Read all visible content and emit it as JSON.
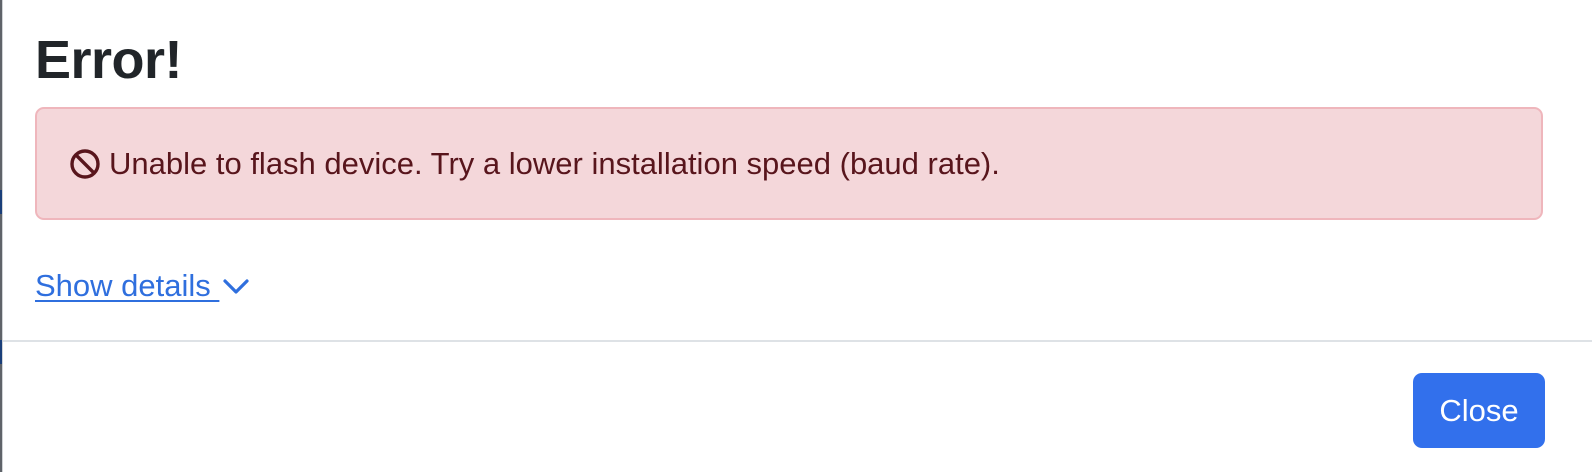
{
  "dialog": {
    "title": "Error!",
    "alert": {
      "icon": "prohibited-icon",
      "message": "Unable to flash device. Try a lower installation speed (baud rate).",
      "background_color": "#f4d7da",
      "border_color": "#efb6bc",
      "text_color": "#58151c"
    },
    "details_toggle": {
      "label": "Show details ",
      "icon": "chevron-down-icon",
      "color": "#2f6fde"
    },
    "footer": {
      "close_label": "Close",
      "close_color": "#3270ec"
    }
  }
}
